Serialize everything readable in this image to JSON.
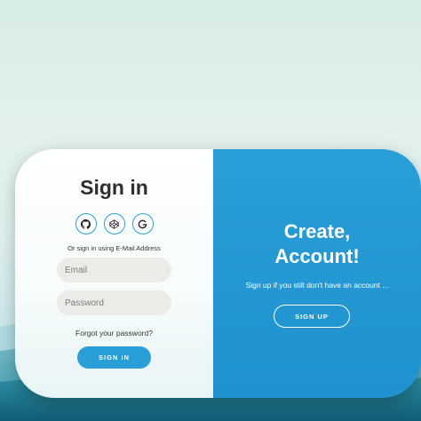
{
  "colors": {
    "accent": "#2a9ed6",
    "panel_right": "#1f92cf",
    "input_bg": "#ecebe8",
    "title_text": "#2f2f2f"
  },
  "sign_in": {
    "title": "Sign in",
    "social_icons": [
      "github-icon",
      "codepen-icon",
      "google-icon"
    ],
    "alt_text": "Or sign in using E-Mail Address",
    "email_placeholder": "Email",
    "password_placeholder": "Password",
    "forgot_text": "Forgot your password?",
    "button_label": "SIGN IN"
  },
  "create_account": {
    "title_line1": "Create,",
    "title_line2": "Account!",
    "subtitle": "Sign up if you still don't have an account ...",
    "button_label": "SIGN UP"
  }
}
